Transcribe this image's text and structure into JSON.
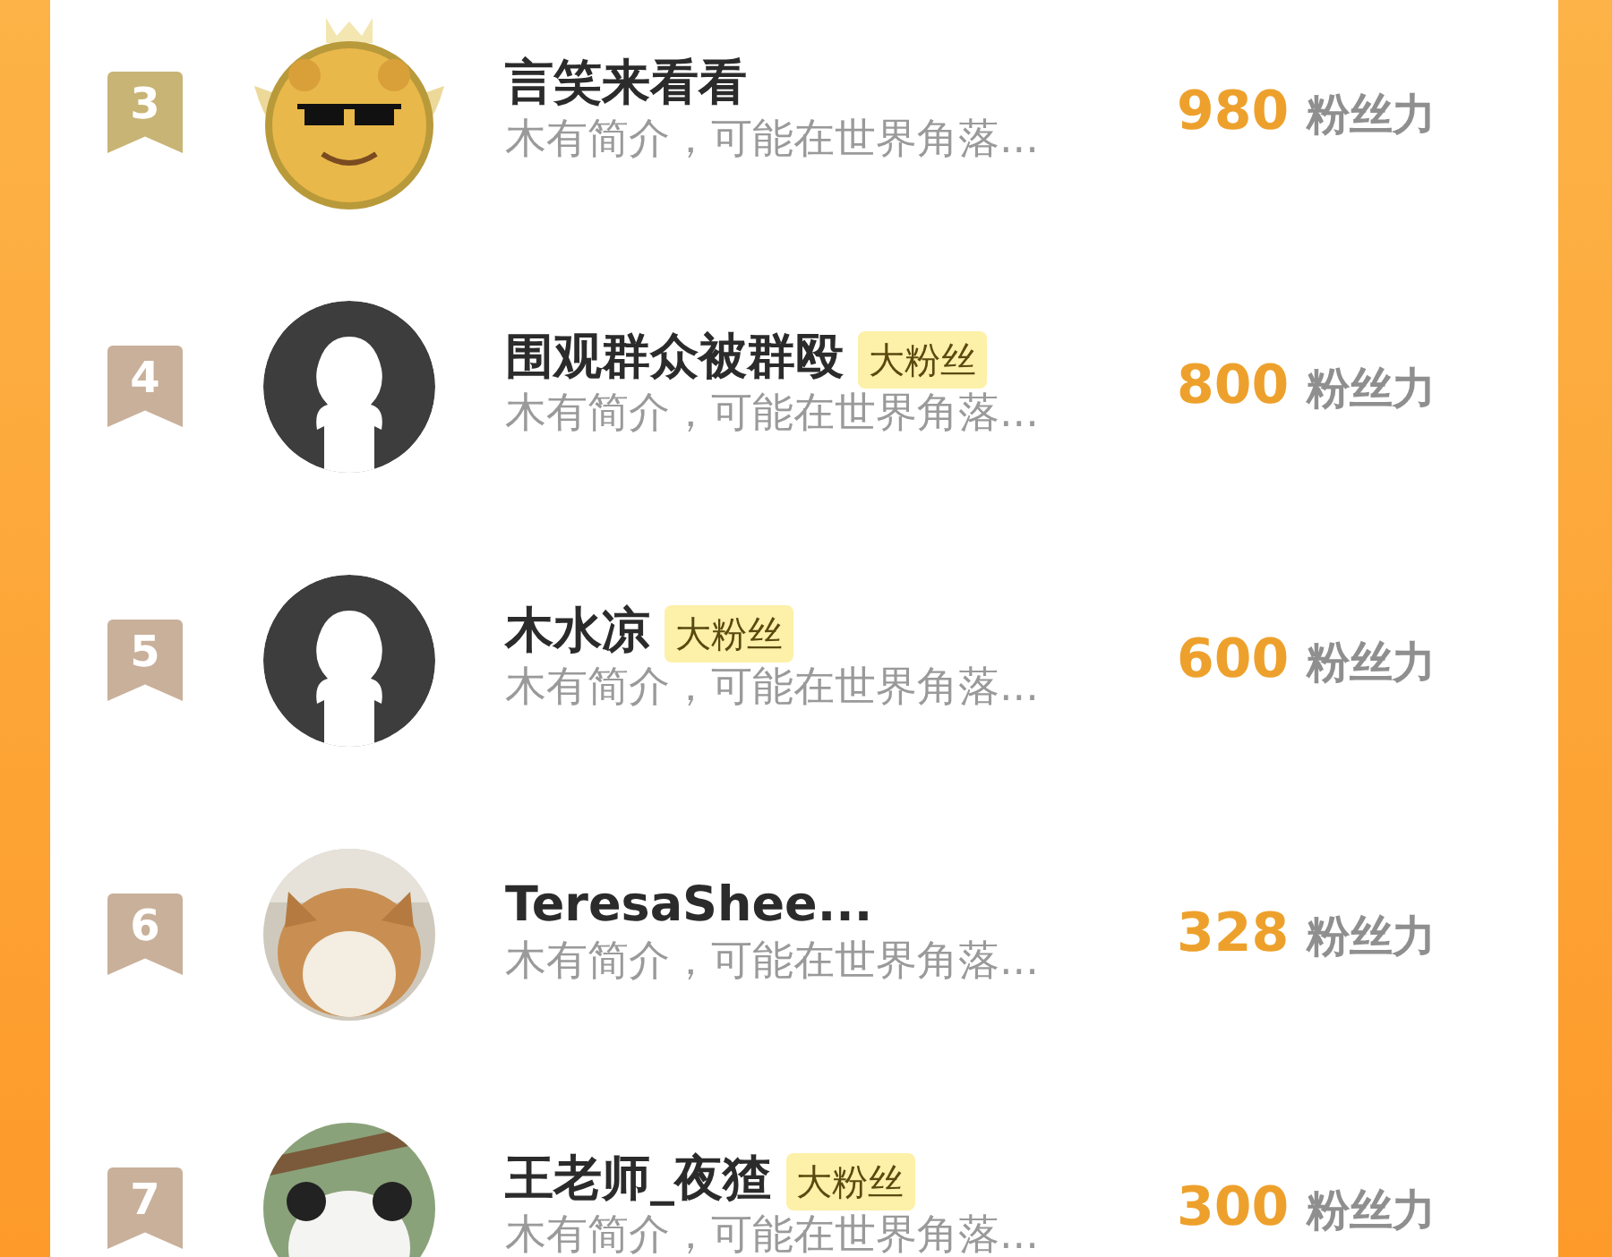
{
  "ranking": [
    {
      "rank": "3",
      "color": "#c8b475",
      "avatar": {
        "kind": "leopard"
      },
      "name": "言笑来看看",
      "bio": "木有简介，可能在世界角落...",
      "score": "980",
      "score_label": "粉丝力"
    },
    {
      "rank": "4",
      "color": "#c9b09a",
      "avatar": {
        "kind": "default"
      },
      "name": "围观群众被群殴",
      "tag": "大粉丝",
      "bio": "木有简介，可能在世界角落...",
      "score": "800",
      "score_label": "粉丝力"
    },
    {
      "rank": "5",
      "color": "#c9b09a",
      "avatar": {
        "kind": "default"
      },
      "name": "木水凉",
      "tag": "大粉丝",
      "bio": "木有简介，可能在世界角落...",
      "score": "600",
      "score_label": "粉丝力"
    },
    {
      "rank": "6",
      "color": "#c9b09a",
      "name": "TeresaShee...",
      "bio": "木有简介，可能在世界角落...",
      "score": "328",
      "score_label": "粉丝力"
    },
    {
      "rank": "7",
      "color": "#c9b09a",
      "name": "王老师_夜猹",
      "tag": "大粉丝",
      "bio": "木有简介，可能在世界角落...",
      "score": "300",
      "score_label": "粉丝力"
    }
  ]
}
